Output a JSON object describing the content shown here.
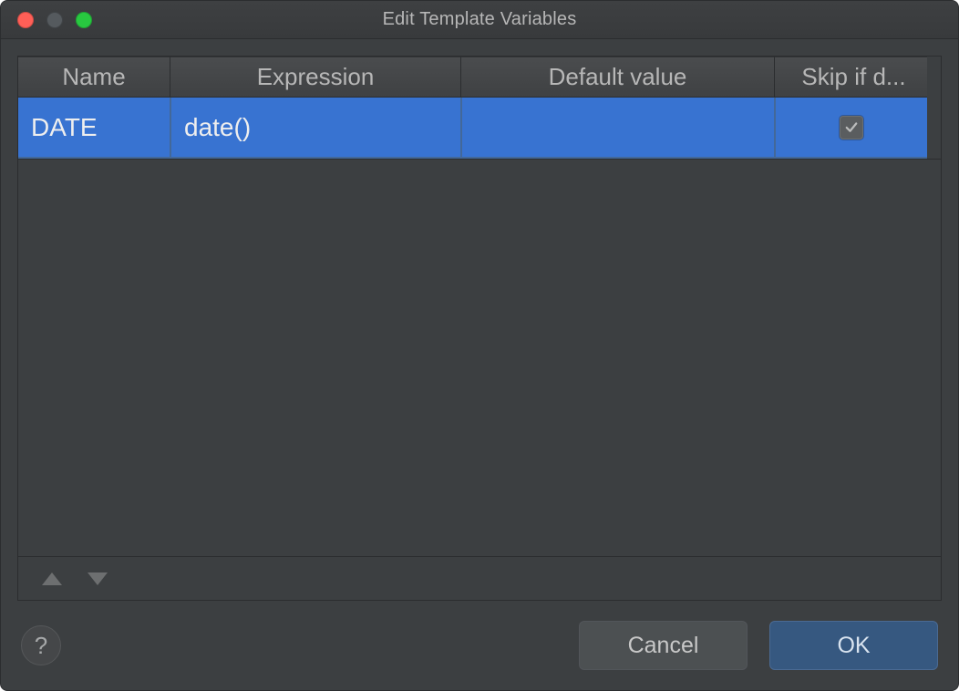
{
  "window": {
    "title": "Edit Template Variables"
  },
  "table": {
    "headers": {
      "name": "Name",
      "expression": "Expression",
      "default_value": "Default value",
      "skip_if_defined": "Skip if d..."
    },
    "rows": [
      {
        "name": "DATE",
        "expression": "date()",
        "default_value": "",
        "skip_if_defined": true
      }
    ]
  },
  "buttons": {
    "cancel": "Cancel",
    "ok": "OK",
    "help": "?"
  }
}
